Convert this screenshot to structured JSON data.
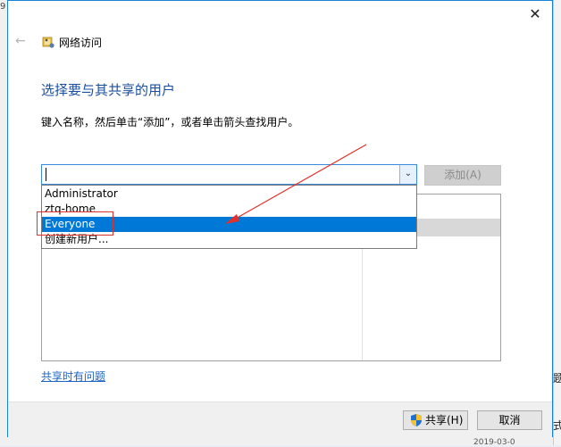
{
  "background": {
    "left_edge_text": "9",
    "right_edge_chars": [
      "题",
      "式"
    ],
    "bottom_text": "2019-03-0"
  },
  "dialog": {
    "title": "网络访问",
    "close_glyph": "✕",
    "back_glyph": "←",
    "heading": "选择要与其共享的用户",
    "instruction": "键入名称，然后单击“添加”，或者单击箭头查找用户。",
    "combo": {
      "value": "",
      "dropdown_glyph": "⌄"
    },
    "add_button": "添加(A)",
    "dropdown_items": [
      {
        "label": "Administrator",
        "selected": false
      },
      {
        "label": "ztq-home",
        "selected": false
      },
      {
        "label": "Everyone",
        "selected": true
      },
      {
        "label": "创建新用户...",
        "selected": false
      }
    ],
    "help_link": "共享时有问题",
    "share_button": "共享(H)",
    "cancel_button": "取消"
  },
  "colors": {
    "accent": "#0078d7",
    "heading": "#1a4fa0",
    "annotation_red": "#e0322b"
  }
}
